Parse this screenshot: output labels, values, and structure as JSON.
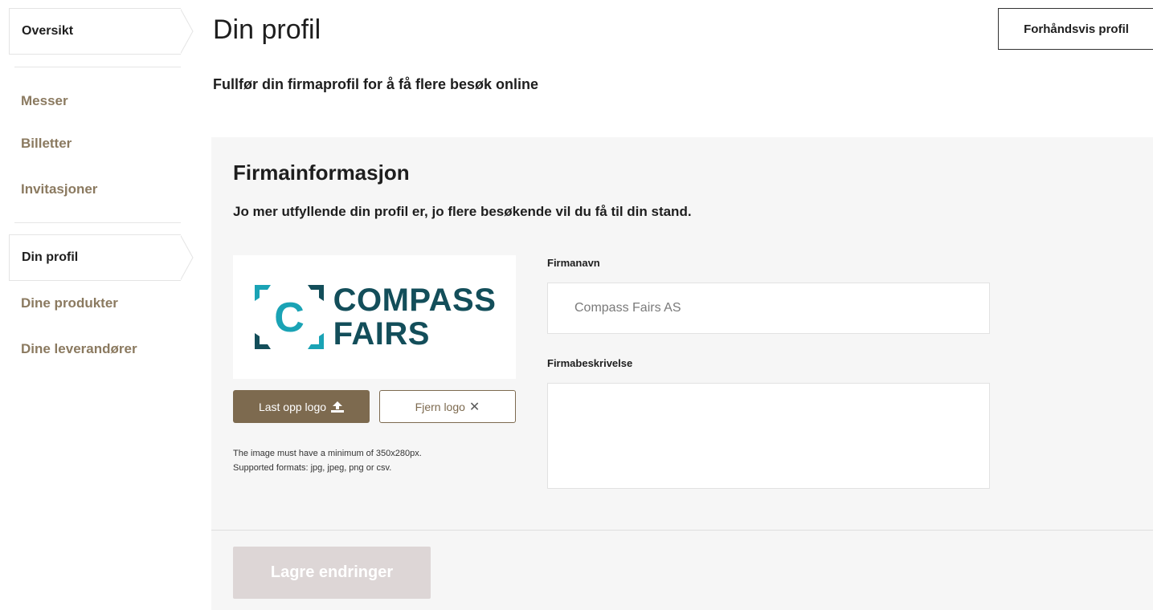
{
  "sidebar": {
    "items": [
      {
        "label": "Oversikt",
        "active": true
      },
      {
        "label": "Messer",
        "active": false
      },
      {
        "label": "Billetter",
        "active": false
      },
      {
        "label": "Invitasjoner",
        "active": false
      },
      {
        "label": "Din profil",
        "active": true
      },
      {
        "label": "Dine produkter",
        "active": false
      },
      {
        "label": "Dine leverandører",
        "active": false
      }
    ]
  },
  "header": {
    "title": "Din profil",
    "preview_label": "Forhåndsvis profil",
    "subtitle": "Fullfør din firmaprofil for å få flere besøk online"
  },
  "company_section": {
    "title": "Firmainformasjon",
    "description": "Jo mer utfyllende din profil er, jo flere besøkende vil du få til din stand.",
    "logo": {
      "line1": "COMPASS",
      "line2": "FAIRS",
      "mark_letter": "C",
      "brand_color": "#134e5a",
      "accent_color": "#1aa3b5"
    },
    "upload_label": "Last opp logo",
    "remove_label": "Fjern logo",
    "hint_line1": "The image must have a minimum of 350x280px.",
    "hint_line2": "Supported formats: jpg, jpeg, png or csv.",
    "name_label": "Firmanavn",
    "name_value": "Compass Fairs AS",
    "description_label": "Firmabeskrivelse",
    "description_value": ""
  },
  "footer": {
    "save_label": "Lagre endringer"
  },
  "colors": {
    "nav_text": "#8b7a60",
    "primary_button": "#7d6a4f",
    "disabled_button": "#ddd6d6",
    "panel_bg": "#f6f6f6"
  },
  "icons": {
    "upload": "upload-icon",
    "remove": "close-icon"
  }
}
